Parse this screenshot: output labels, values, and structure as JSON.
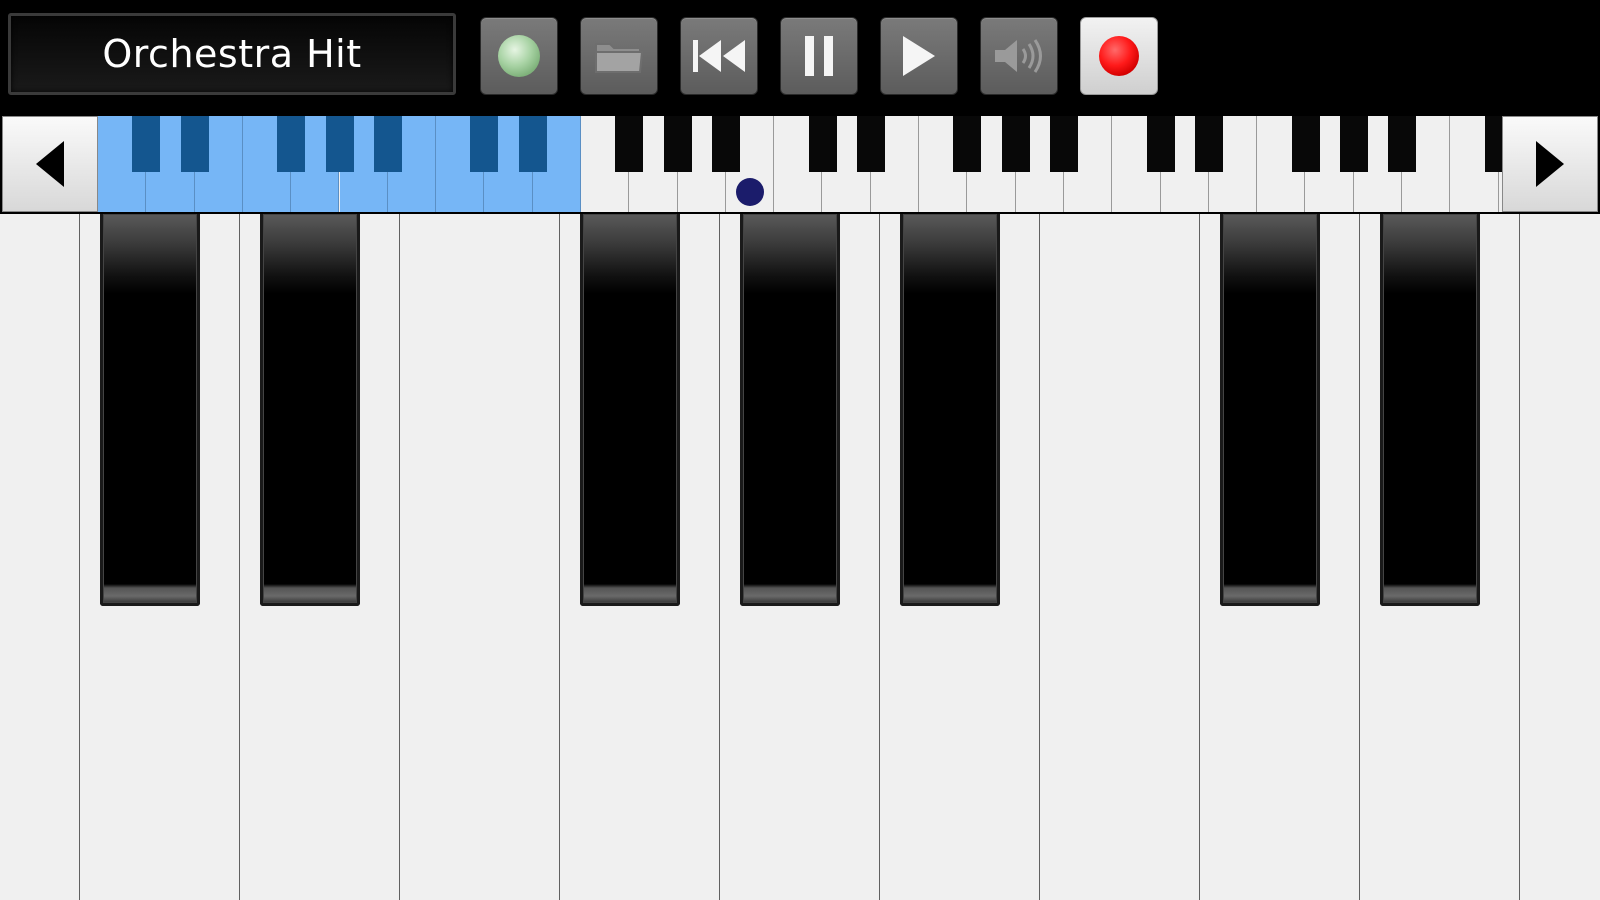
{
  "toolbar": {
    "instrument_name": "Orchestra Hit",
    "buttons": [
      {
        "name": "metronome-button",
        "icon": "green-circle-icon"
      },
      {
        "name": "open-file-button",
        "icon": "folder-icon"
      },
      {
        "name": "rewind-button",
        "icon": "skip-back-icon"
      },
      {
        "name": "pause-button",
        "icon": "pause-icon"
      },
      {
        "name": "play-button",
        "icon": "play-icon"
      },
      {
        "name": "volume-button",
        "icon": "speaker-icon"
      },
      {
        "name": "record-button",
        "icon": "record-icon"
      }
    ]
  },
  "navigator": {
    "left_arrow_icon": "triangle-left-icon",
    "right_arrow_icon": "triangle-right-icon",
    "highlight_color": "#76b6f6",
    "highlight_black_color": "#14568f",
    "dot_color": "#1b1c6b"
  },
  "colors": {
    "background": "#000000",
    "white_key": "#f0f0f0",
    "black_key": "#000000",
    "record_red": "#ff1a1a",
    "metronome_green": "#a7d2a3"
  }
}
